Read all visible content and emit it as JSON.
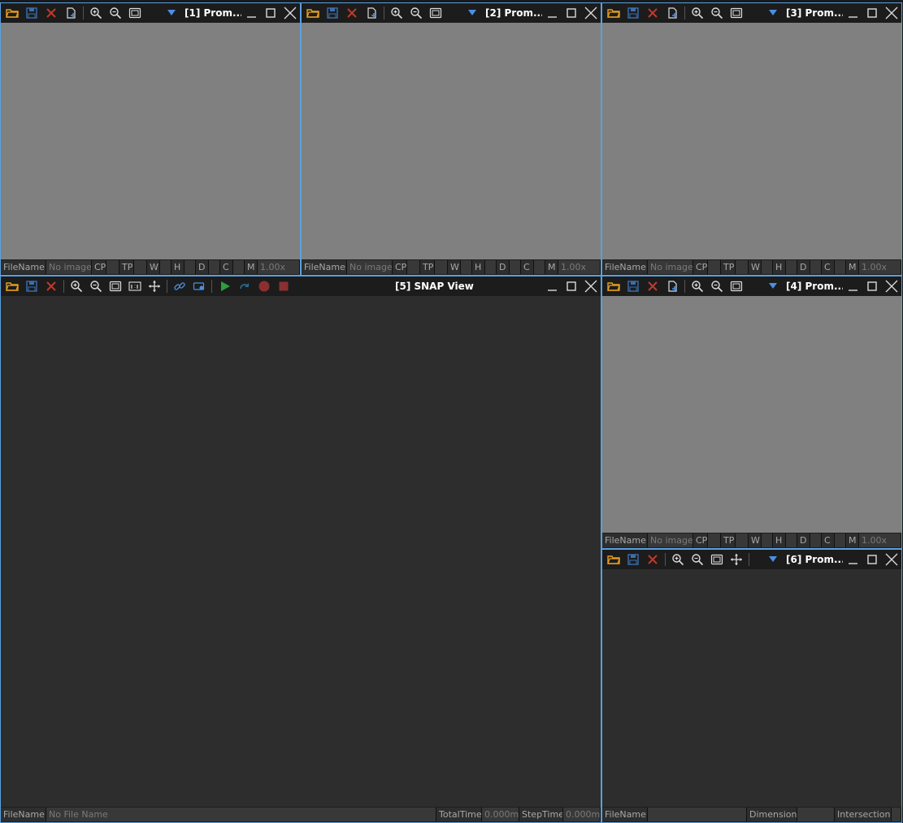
{
  "panels": {
    "p1": {
      "title": "[1] Prom...",
      "status": {
        "filename_label": "FileName",
        "filename_value": "No image",
        "cp": "CP",
        "tp": "TP",
        "w": "W",
        "h": "H",
        "d": "D",
        "c": "C",
        "m": "M",
        "zoom": "1.00x"
      }
    },
    "p2": {
      "title": "[2] Prom...",
      "status": {
        "filename_label": "FileName",
        "filename_value": "No image",
        "cp": "CP",
        "tp": "TP",
        "w": "W",
        "h": "H",
        "d": "D",
        "c": "C",
        "m": "M",
        "zoom": "1.00x"
      }
    },
    "p3": {
      "title": "[3] Prom...",
      "status": {
        "filename_label": "FileName",
        "filename_value": "No image",
        "cp": "CP",
        "tp": "TP",
        "w": "W",
        "h": "H",
        "d": "D",
        "c": "C",
        "m": "M",
        "zoom": "1.00x"
      }
    },
    "p4": {
      "title": "[4] Prom...",
      "status": {
        "filename_label": "FileName",
        "filename_value": "No image",
        "cp": "CP",
        "tp": "TP",
        "w": "W",
        "h": "H",
        "d": "D",
        "c": "C",
        "m": "M",
        "zoom": "1.00x"
      }
    },
    "p5": {
      "title": "[5] SNAP View",
      "status": {
        "filename_label": "FileName",
        "filename_value": "No File Name",
        "totaltime_label": "TotalTime",
        "totaltime_value": "0.000ms",
        "steptime_label": "StepTime",
        "steptime_value": "0.000ms"
      }
    },
    "p6": {
      "title": "[6] Prom...",
      "status": {
        "filename_label": "FileName",
        "dimension_label": "Dimension",
        "intersection_label": "Intersection"
      }
    }
  },
  "icons": {
    "open": "folder-open-icon",
    "save": "save-icon",
    "close": "close-red-x-icon",
    "add": "add-document-icon",
    "zoom_in": "zoom-in-icon",
    "zoom_out": "zoom-out-icon",
    "fit": "fit-window-icon",
    "one_to_one": "actual-size-icon",
    "pan": "pan-move-icon",
    "link": "link-icon",
    "overlay": "overlay-icon",
    "play": "play-icon",
    "step": "step-icon",
    "record": "record-icon",
    "stop": "stop-icon"
  },
  "colors": {
    "image_bg": "#808080",
    "dark_bg": "#2d2d2d",
    "toolbar_bg": "#1c1c1c",
    "accent_blue": "#4a90e2",
    "folder_orange": "#e8a020",
    "close_red": "#c0392b",
    "play_green": "#2e9e3e"
  }
}
